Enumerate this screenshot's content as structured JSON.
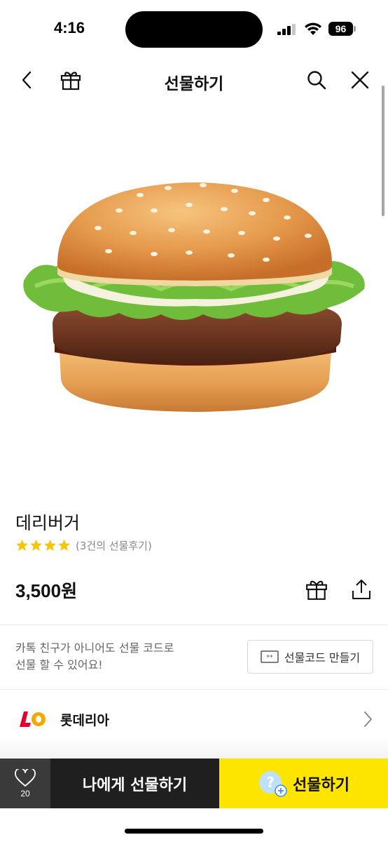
{
  "status_bar": {
    "time": "4:16",
    "battery": "96"
  },
  "nav": {
    "title": "선물하기",
    "back_icon": "chevron-left-icon",
    "gift_icon": "gift-icon",
    "search_icon": "search-icon",
    "close_icon": "close-icon"
  },
  "product": {
    "image": "burger-image",
    "name": "데리버거",
    "rating_stars": 4,
    "rating_max": 5,
    "review_text": "(3건의 선물후기)",
    "price_number": "3,500",
    "price_unit": "원"
  },
  "gift_code": {
    "description_line1": "카톡 친구가 아니어도 선물 코드로",
    "description_line2": "선물 할 수 있어요!",
    "button_label": "선물코드 만들기"
  },
  "brand": {
    "name": "롯데리아"
  },
  "bottom_bar": {
    "wish_count": "20",
    "self_gift_label": "나에게 선물하기",
    "gift_label": "선물하기"
  },
  "colors": {
    "accent_yellow": "#fee500",
    "star": "#f7c600",
    "dark_button": "#1f1f1f",
    "wish_button": "#3a3a3a",
    "brand_red": "#e4002b"
  }
}
